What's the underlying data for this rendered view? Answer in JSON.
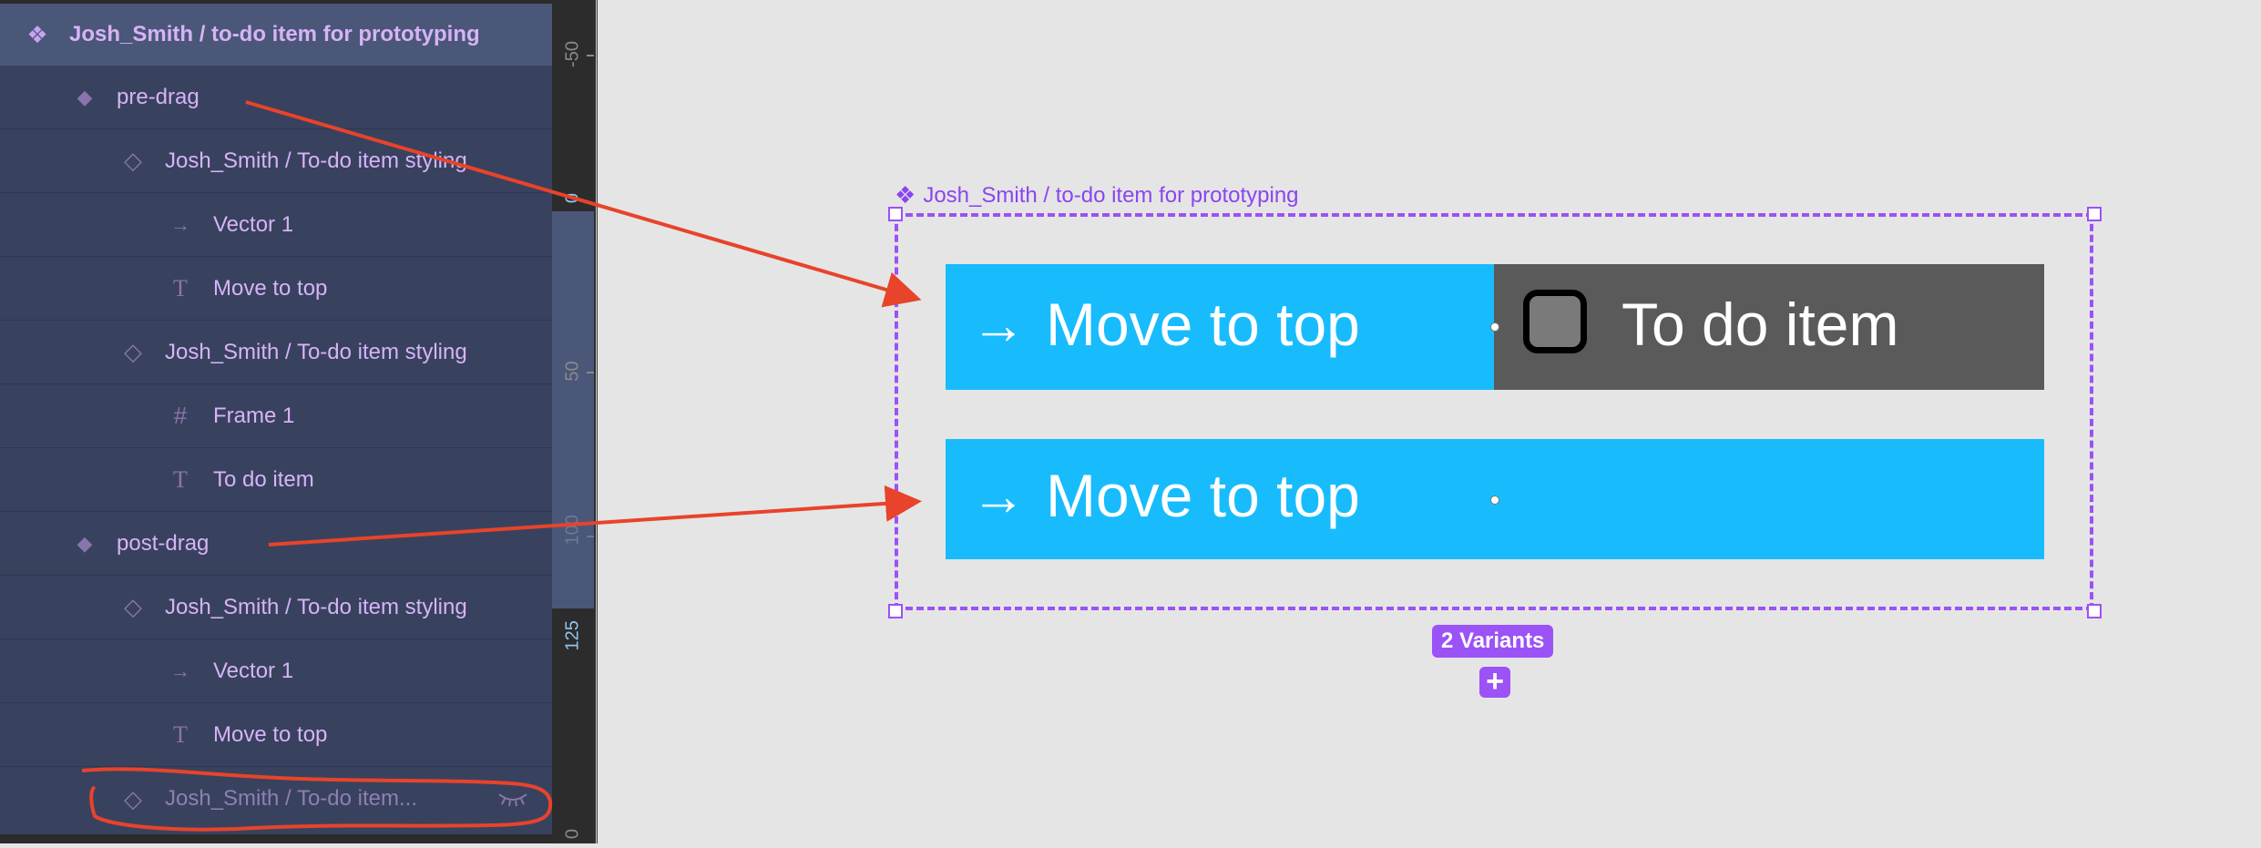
{
  "layers": {
    "items": [
      {
        "label": "Josh_Smith / to-do item for prototyping",
        "icon": "component-set-icon",
        "glyph": "❖",
        "depth": 0,
        "selected": true
      },
      {
        "label": "pre-drag",
        "icon": "variant-icon",
        "glyph": "◆",
        "depth": 1
      },
      {
        "label": "Josh_Smith / To-do item styling",
        "icon": "instance-icon",
        "glyph": "◇",
        "depth": 2
      },
      {
        "label": "Vector 1",
        "icon": "vector-icon",
        "glyph": "→",
        "depth": 3
      },
      {
        "label": "Move to top",
        "icon": "text-icon",
        "glyph": "T",
        "depth": 3
      },
      {
        "label": "Josh_Smith / To-do item styling",
        "icon": "instance-icon",
        "glyph": "◇",
        "depth": 2
      },
      {
        "label": "Frame 1",
        "icon": "frame-icon",
        "glyph": "#",
        "depth": 3
      },
      {
        "label": "To do item",
        "icon": "text-icon",
        "glyph": "T",
        "depth": 3
      },
      {
        "label": "post-drag",
        "icon": "variant-icon",
        "glyph": "◆",
        "depth": 1
      },
      {
        "label": "Josh_Smith / To-do item styling",
        "icon": "instance-icon",
        "glyph": "◇",
        "depth": 2
      },
      {
        "label": "Vector 1",
        "icon": "vector-icon",
        "glyph": "→",
        "depth": 3
      },
      {
        "label": "Move to top",
        "icon": "text-icon",
        "glyph": "T",
        "depth": 3
      },
      {
        "label": "Josh_Smith / To-do item...",
        "icon": "instance-icon",
        "glyph": "◇",
        "depth": 2,
        "hidden": true
      }
    ]
  },
  "ruler": {
    "labels": [
      "-50",
      "0",
      "50",
      "100",
      "125",
      "0"
    ]
  },
  "canvas": {
    "component_set": {
      "title": "Josh_Smith / to-do item for prototyping",
      "title_icon": "❖",
      "variants": [
        {
          "name": "pre-drag",
          "move_arrow": "→",
          "move_label": "Move to top",
          "todo_label": "To do item"
        },
        {
          "name": "post-drag",
          "move_arrow": "→",
          "move_label": "Move to top"
        }
      ]
    },
    "variants_badge": "2 Variants",
    "add_variant_glyph": "+"
  },
  "colors": {
    "accent_purple": "#9b52f7",
    "swipe_blue": "#18bcfc",
    "todo_gray": "#5a5a5a",
    "annotation_red": "#e8432b",
    "layer_text": "#d7b3f7"
  }
}
